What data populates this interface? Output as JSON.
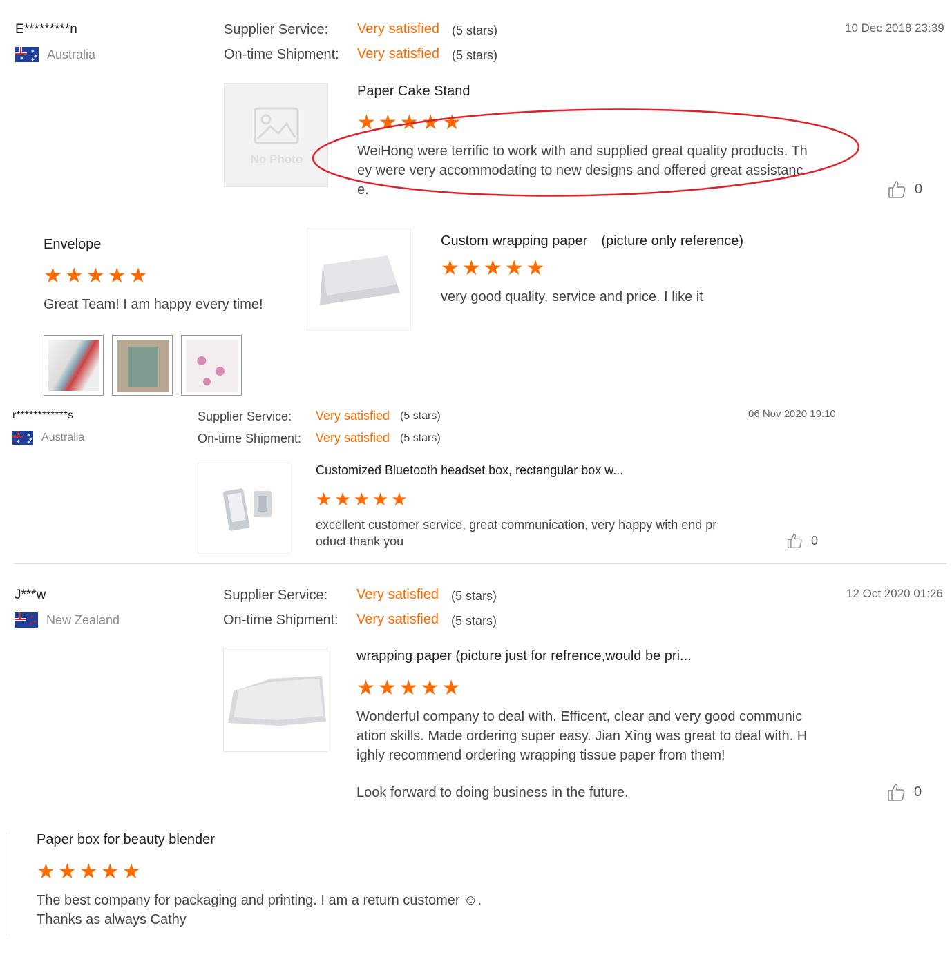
{
  "labels": {
    "supplier_service": "Supplier Service:",
    "ontime_shipment": "On-time Shipment:"
  },
  "review1": {
    "name": "E*********n",
    "country": "Australia",
    "supplier_rating": "Very satisfied",
    "supplier_stars": "(5 stars)",
    "shipment_rating": "Very satisfied",
    "shipment_stars": "(5 stars)",
    "date": "10 Dec 2018 23:39",
    "no_photo": "No Photo",
    "product": "Paper Cake Stand",
    "rating": 5,
    "text_line1": "WeiHong were terrific to work with and supplied great quality products. Th",
    "text_line2": "ey were very accommodating to new designs and offered great assistanc",
    "text_line3": "e.",
    "likes": "0",
    "highlight_color": "#e0202a"
  },
  "review_envelope": {
    "product": "Envelope",
    "rating": 5,
    "text": "Great Team! I am happy every time!"
  },
  "review_wrapping": {
    "product": "Custom wrapping paper　(picture only reference)",
    "rating": 5,
    "text": "very good quality, service and price. I like it"
  },
  "review2": {
    "name": "r************s",
    "country": "Australia",
    "supplier_rating": "Very satisfied",
    "supplier_stars": "(5 stars)",
    "shipment_rating": "Very satisfied",
    "shipment_stars": "(5 stars)",
    "date": "06 Nov 2020 19:10",
    "product": "Customized Bluetooth headset box, rectangular box w...",
    "rating": 5,
    "text_line1": "excellent customer service, great communication, very happy with end pr",
    "text_line2": "oduct thank you",
    "likes": "0"
  },
  "review3": {
    "name": "J***w",
    "country": "New Zealand",
    "supplier_rating": "Very satisfied",
    "supplier_stars": "(5 stars)",
    "shipment_rating": "Very satisfied",
    "shipment_stars": "(5 stars)",
    "date": "12 Oct 2020 01:26",
    "product": "wrapping paper (picture just for refrence,would be pri...",
    "rating": 5,
    "text_line1": "Wonderful company to deal with. Efficent, clear and very good communic",
    "text_line2": "ation skills. Made ordering super easy. Jian Xing was great to deal with. H",
    "text_line3": "ighly recommend ordering wrapping tissue paper from them!",
    "text_line4": "Look forward to doing business in the future.",
    "likes": "0"
  },
  "review_beauty": {
    "product": "Paper box for beauty blender",
    "rating": 5,
    "text_line1": "The best company for packaging and printing. I am a return customer ☺.",
    "text_line2": "Thanks as always Cathy"
  },
  "colors": {
    "accent": "#ff6a00",
    "muted": "#8a8a8a",
    "divider": "#dcdcdc"
  },
  "icons": [
    "flag-australia-icon",
    "flag-new-zealand-icon",
    "star-icon",
    "thumbs-up-icon",
    "no-photo-icon"
  ]
}
